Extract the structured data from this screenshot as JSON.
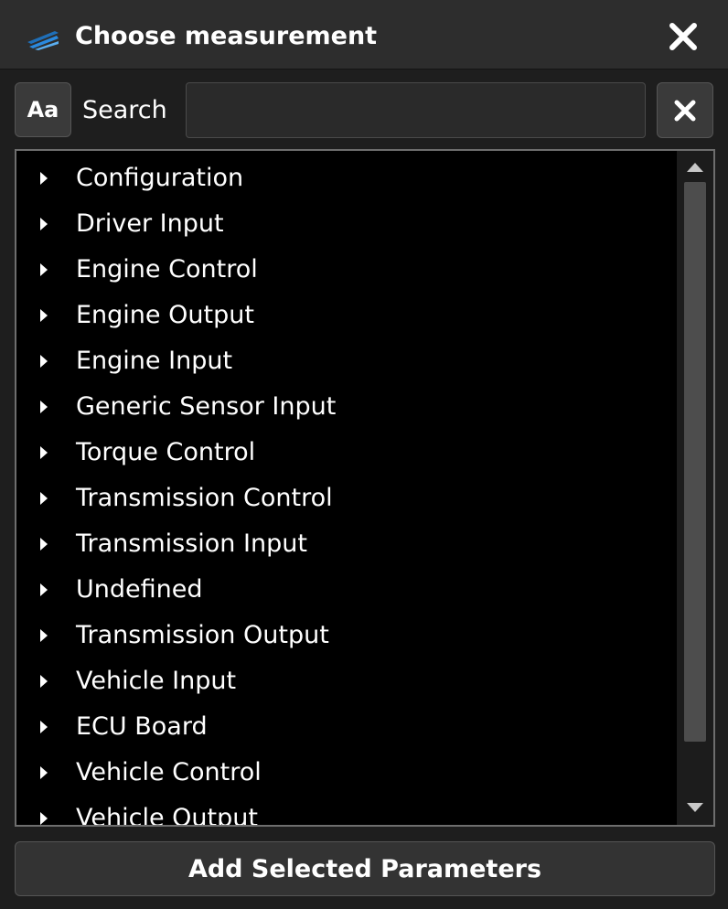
{
  "window": {
    "title": "Choose measurement",
    "logo_icon": "app-logo-icon",
    "close_icon": "close-icon"
  },
  "search": {
    "case_button_label": "Aa",
    "label": "Search",
    "value": "",
    "placeholder": "",
    "clear_icon": "close-icon"
  },
  "tree": {
    "items": [
      {
        "label": "Configuration",
        "expanded": false
      },
      {
        "label": "Driver Input",
        "expanded": false
      },
      {
        "label": "Engine Control",
        "expanded": false
      },
      {
        "label": "Engine Output",
        "expanded": false
      },
      {
        "label": "Engine Input",
        "expanded": false
      },
      {
        "label": "Generic Sensor Input",
        "expanded": false
      },
      {
        "label": "Torque Control",
        "expanded": false
      },
      {
        "label": "Transmission Control",
        "expanded": false
      },
      {
        "label": "Transmission Input",
        "expanded": false
      },
      {
        "label": "Undefined",
        "expanded": false
      },
      {
        "label": "Transmission Output",
        "expanded": false
      },
      {
        "label": "Vehicle Input",
        "expanded": false
      },
      {
        "label": "ECU Board",
        "expanded": false
      },
      {
        "label": "Vehicle Control",
        "expanded": false
      },
      {
        "label": "Vehicle Output",
        "expanded": false
      }
    ]
  },
  "footer": {
    "add_button_label": "Add Selected Parameters"
  },
  "colors": {
    "background": "#1e1e1e",
    "titlebar": "#2d2d2d",
    "tree_background": "#000000",
    "accent_logo": "#2a7fd4"
  }
}
